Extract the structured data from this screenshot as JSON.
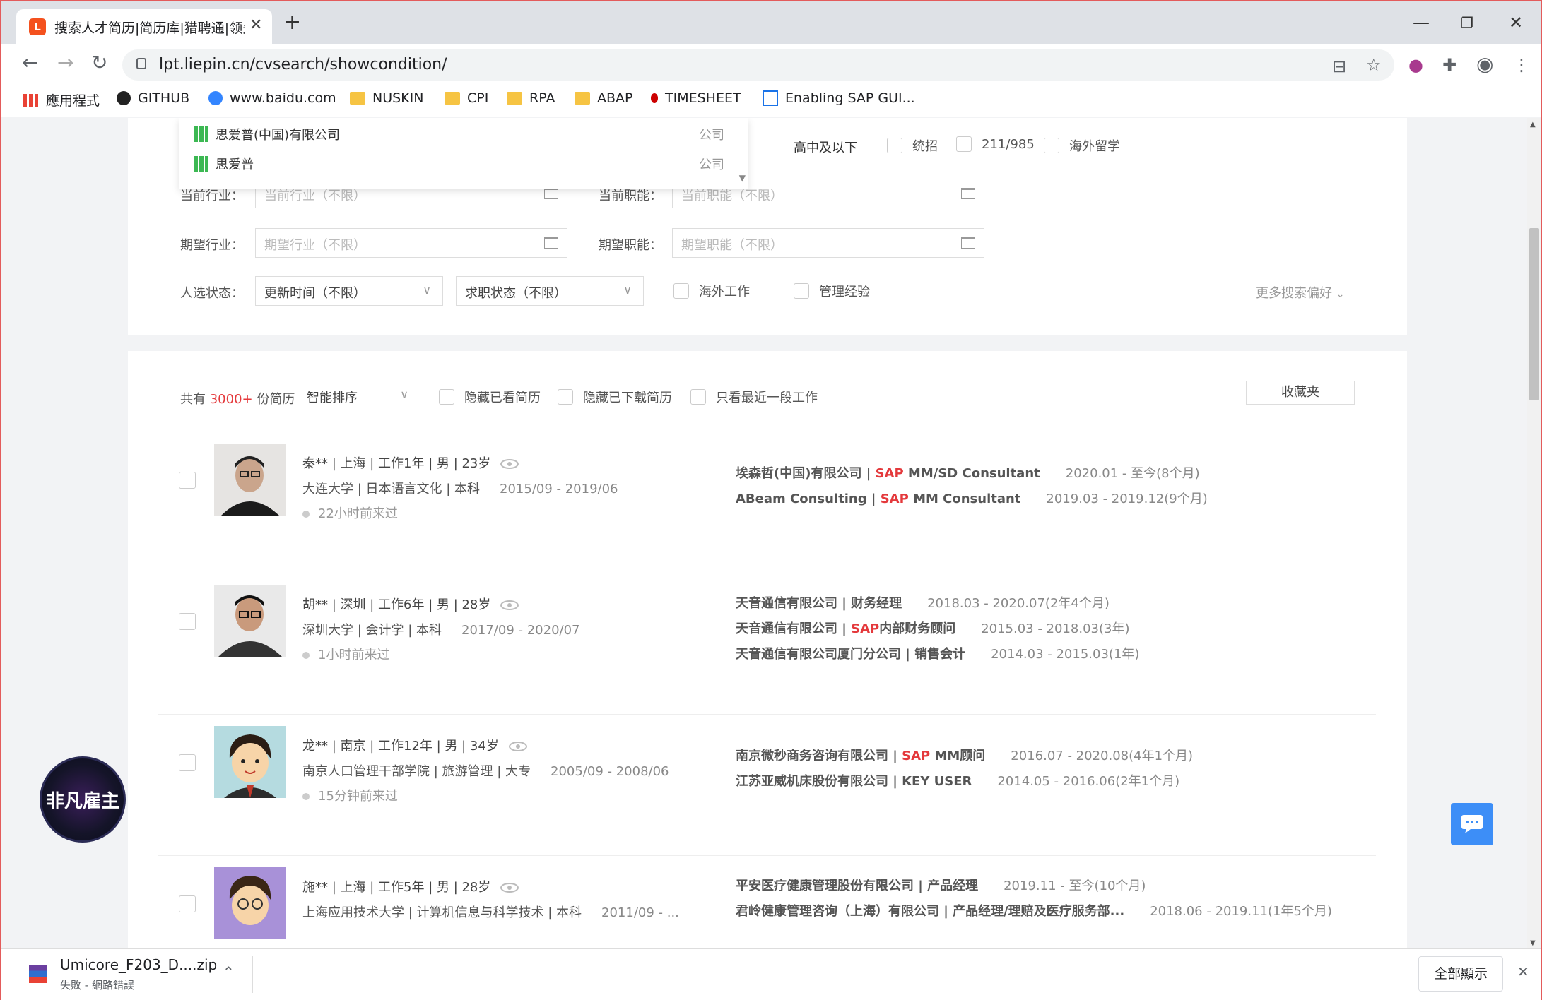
{
  "browser": {
    "tab_title": "搜索人才简历|简历库|猎聘通|领先",
    "url": "lpt.liepin.cn/cvsearch/showcondition/",
    "bookmarks": [
      "應用程式",
      "GITHUB",
      "www.baidu.com",
      "NUSKIN",
      "CPI",
      "RPA",
      "ABAP",
      "TIMESHEET",
      "Enabling SAP GUI..."
    ]
  },
  "dropdown": {
    "items": [
      {
        "name": "思爱普(中国)有限公司",
        "type": "公司"
      },
      {
        "name": "思爱普",
        "type": "公司"
      }
    ]
  },
  "filters": {
    "edu_option": "高中及以下",
    "checks_top": [
      "统招",
      "211/985",
      "海外留学"
    ],
    "current_industry_label": "当前行业：",
    "current_industry_ph": "当前行业（不限）",
    "current_func_label": "当前职能：",
    "current_func_ph": "当前职能（不限）",
    "expected_industry_label": "期望行业：",
    "expected_industry_ph": "期望行业（不限）",
    "expected_func_label": "期望职能：",
    "expected_func_ph": "期望职能（不限）",
    "status_label": "人选状态：",
    "update_time": "更新时间（不限）",
    "job_status": "求职状态（不限）",
    "overseas": "海外工作",
    "mgmt": "管理经验",
    "more_prefs": "更多搜索偏好"
  },
  "results_bar": {
    "prefix": "共有",
    "count": "3000+",
    "suffix": "份简历",
    "sort": "智能排序",
    "hide_viewed": "隐藏已看简历",
    "hide_downloaded": "隐藏已下载简历",
    "recent_only": "只看最近一段工作",
    "favorites": "收藏夹"
  },
  "candidates": [
    {
      "basic": "秦** | 上海 | 工作1年 | 男 | 23岁",
      "edu": "大连大学 | 日本语言文化 | 本科",
      "edu_period": "2015/09 - 2019/06",
      "active": "22小时前来过",
      "exp": [
        {
          "pre": "埃森哲(中国)有限公司 | ",
          "sap": "SAP",
          "post": " MM/SD Consultant",
          "date": "2020.01 - 至今(8个月)"
        },
        {
          "pre": "ABeam Consulting | ",
          "sap": "SAP",
          "post": " MM Consultant",
          "date": "2019.03 - 2019.12(9个月)"
        }
      ]
    },
    {
      "basic": "胡** | 深圳 | 工作6年 | 男 | 28岁",
      "edu": "深圳大学 | 会计学 | 本科",
      "edu_period": "2017/09 - 2020/07",
      "active": "1小时前来过",
      "exp": [
        {
          "pre": "天音通信有限公司 | 财务经理",
          "sap": "",
          "post": "",
          "date": "2018.03 - 2020.07(2年4个月)"
        },
        {
          "pre": "天音通信有限公司 | ",
          "sap": "SAP",
          "post": "内部财务顾问",
          "date": "2015.03 - 2018.03(3年)"
        },
        {
          "pre": "天音通信有限公司厦门分公司 | 销售会计",
          "sap": "",
          "post": "",
          "date": "2014.03 - 2015.03(1年)"
        }
      ]
    },
    {
      "basic": "龙** | 南京 | 工作12年 | 男 | 34岁",
      "edu": "南京人口管理干部学院 | 旅游管理 | 大专",
      "edu_period": "2005/09 - 2008/06",
      "active": "15分钟前来过",
      "exp": [
        {
          "pre": "南京微秒商务咨询有限公司 | ",
          "sap": "SAP",
          "post": " MM顾问",
          "date": "2016.07 - 2020.08(4年1个月)"
        },
        {
          "pre": "江苏亚威机床股份有限公司 | KEY USER",
          "sap": "",
          "post": "",
          "date": "2014.05 - 2016.06(2年1个月)"
        }
      ]
    },
    {
      "basic": "施** | 上海 | 工作5年 | 男 | 28岁",
      "edu": "上海应用技术大学 | 计算机信息与科学技术 | 本科",
      "edu_period": "2011/09 - ...",
      "active": "",
      "exp": [
        {
          "pre": "平安医疗健康管理股份有限公司 | 产品经理",
          "sap": "",
          "post": "",
          "date": "2019.11 - 至今(10个月)"
        },
        {
          "pre": "君岭健康管理咨询（上海）有限公司 | 产品经理/理赔及医疗服务部...",
          "sap": "",
          "post": "",
          "date": "2018.06 - 2019.11(1年5个月)"
        }
      ]
    }
  ],
  "badge_text": "非凡雇主",
  "download": {
    "file": "Umicore_F203_D....zip",
    "status": "失敗 - 網路錯誤",
    "show_all": "全部顯示"
  }
}
